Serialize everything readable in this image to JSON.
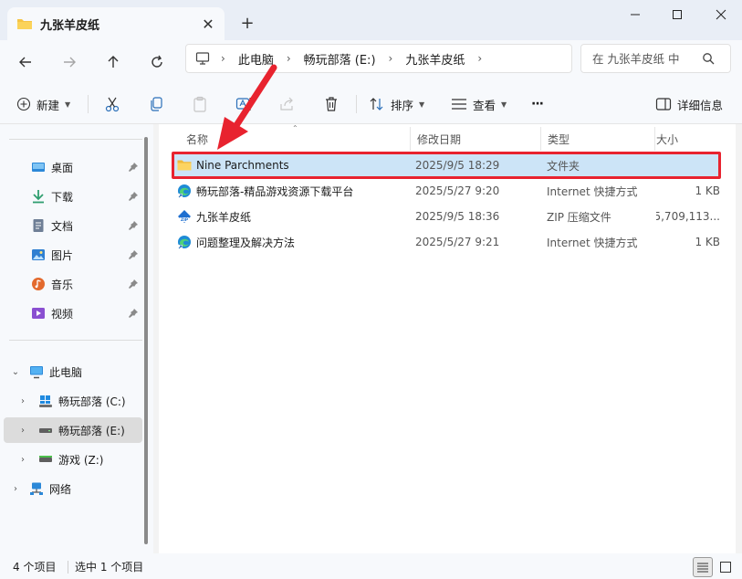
{
  "window": {
    "tab_title": "九张羊皮纸",
    "tab_close": "✕",
    "new_tab": "+",
    "controls": {
      "minimize": "—",
      "maximize": "☐",
      "close": "✕"
    }
  },
  "address": {
    "crumbs": [
      "此电脑",
      "畅玩部落 (E:)",
      "九张羊皮纸"
    ],
    "separator": "›",
    "search_placeholder": "在 九张羊皮纸 中"
  },
  "toolbar": {
    "new_label": "新建",
    "sort_label": "排序",
    "view_label": "查看",
    "more_label": "···",
    "details_label": "详细信息"
  },
  "nav": {
    "quick_access": [
      {
        "label": "桌面",
        "icon": "desktop-icon",
        "color": "#2b88d8"
      },
      {
        "label": "下载",
        "icon": "download-icon",
        "color": "#2f9e6f"
      },
      {
        "label": "文档",
        "icon": "document-icon",
        "color": "#6f7f96"
      },
      {
        "label": "图片",
        "icon": "picture-icon",
        "color": "#2f7fd1"
      },
      {
        "label": "音乐",
        "icon": "music-icon",
        "color": "#e36a2e"
      },
      {
        "label": "视频",
        "icon": "video-icon",
        "color": "#8a4fd1"
      }
    ],
    "this_pc": "此电脑",
    "drives": [
      {
        "label": "畅玩部落 (C:)",
        "icon": "windows-drive-icon"
      },
      {
        "label": "畅玩部落 (E:)",
        "icon": "drive-icon"
      },
      {
        "label": "游戏 (Z:)",
        "icon": "drive-icon"
      }
    ],
    "network": "网络"
  },
  "columns": {
    "name": "名称",
    "date": "修改日期",
    "type": "类型",
    "size": "大小"
  },
  "files": [
    {
      "name": "Nine Parchments",
      "date": "2025/9/5 18:29",
      "type": "文件夹",
      "size": "",
      "icon": "folder-icon"
    },
    {
      "name": "畅玩部落-精品游戏资源下载平台",
      "date": "2025/5/27 9:20",
      "type": "Internet 快捷方式",
      "size": "1 KB",
      "icon": "edge-shortcut-icon"
    },
    {
      "name": "九张羊皮纸",
      "date": "2025/9/5 18:36",
      "type": "ZIP 压缩文件",
      "size": "5,709,113...",
      "icon": "zip-icon"
    },
    {
      "name": "问题整理及解决方法",
      "date": "2025/5/27 9:21",
      "type": "Internet 快捷方式",
      "size": "1 KB",
      "icon": "edge-shortcut-icon"
    }
  ],
  "status": {
    "count": "4 个项目",
    "selected": "选中 1 个项目"
  },
  "colors": {
    "accent": "#0067c0",
    "selection": "#cce4f7",
    "highlight": "#e8232f",
    "folder": "#f6c445"
  }
}
